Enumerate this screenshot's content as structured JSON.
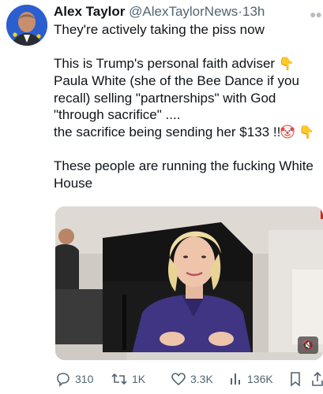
{
  "post": {
    "author_name": "Alex Taylor",
    "author_handle": "@AlexTaylorNews",
    "separator": "·",
    "time": "13h",
    "lines": [
      "They're actively taking the piss now",
      "This is Trump's personal faith adviser",
      "Paula White (she of the Bee Dance if you",
      "recall) selling \"partnerships\" with God",
      "\"through sacrifice\" ....",
      "the sacrifice being sending her $133 !!",
      "These people are running the fucking White",
      "House"
    ]
  },
  "actions": {
    "replies": "310",
    "reposts": "1K",
    "likes": "3.3K",
    "views": "136K"
  },
  "icons": {
    "pointing_down": "pointing-down-emoji",
    "clown": "clown-face-emoji",
    "more": "more-icon",
    "mute": "muted-speaker-icon"
  },
  "colors": {
    "text": "#0f1419",
    "muted": "#536471",
    "emoji_yellow": "#f5b301"
  }
}
